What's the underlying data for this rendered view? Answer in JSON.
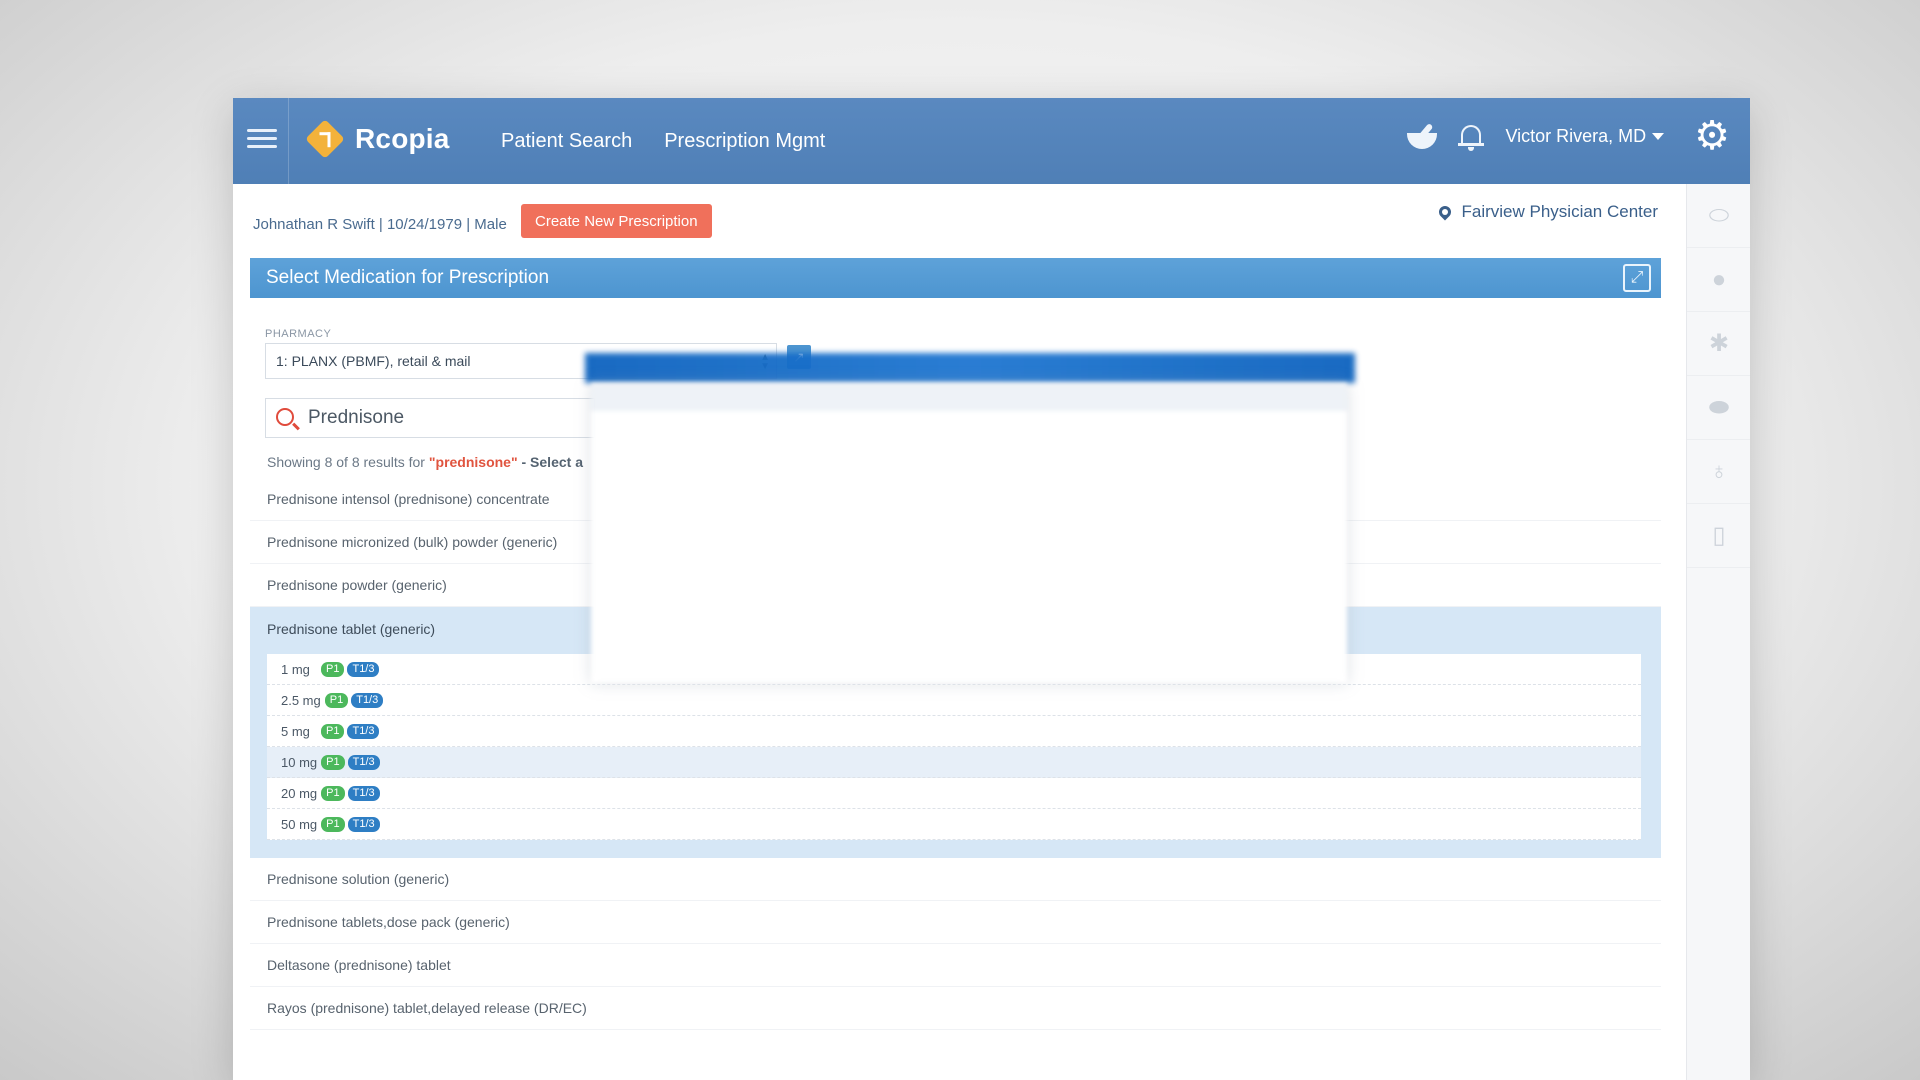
{
  "header": {
    "brand": "Rcopia",
    "nav": [
      {
        "label": "Patient Search"
      },
      {
        "label": "Prescription Mgmt"
      }
    ],
    "user": "Victor Rivera, MD"
  },
  "patient": {
    "info": "Johnathan R Swift | 10/24/1979 | Male",
    "create_button": "Create New Prescription",
    "location": "Fairview Physician Center"
  },
  "section": {
    "title": "Select Medication for Prescription"
  },
  "pharmacy": {
    "label": "PHARMACY",
    "selected": "1: PLANX (PBMF), retail & mail"
  },
  "search": {
    "value": "Prednisone",
    "summary_prefix": "Showing 8 of 8 results for",
    "summary_term": "\"prednisone\"",
    "summary_suffix": " - Select a"
  },
  "results": {
    "before": [
      "Prednisone intensol (prednisone) concentrate",
      "Prednisone micronized (bulk) powder (generic)",
      "Prednisone powder (generic)"
    ],
    "expanded": {
      "name": "Prednisone tablet (generic)",
      "strengths": [
        {
          "label": "1 mg",
          "badges": [
            "P1",
            "T1/3"
          ]
        },
        {
          "label": "2.5 mg",
          "badges": [
            "P1",
            "T1/3"
          ]
        },
        {
          "label": "5 mg",
          "badges": [
            "P1",
            "T1/3"
          ]
        },
        {
          "label": "10 mg",
          "badges": [
            "P1",
            "T1/3"
          ]
        },
        {
          "label": "20 mg",
          "badges": [
            "P1",
            "T1/3"
          ]
        },
        {
          "label": "50 mg",
          "badges": [
            "P1",
            "T1/3"
          ]
        }
      ]
    },
    "after": [
      "Prednisone solution (generic)",
      "Prednisone tablets,dose pack (generic)",
      "Deltasone (prednisone) tablet",
      "Rayos (prednisone) tablet,delayed release (DR/EC)"
    ]
  },
  "icons": {
    "menu": "hamburger-icon",
    "rx": "mortar-pestle-icon",
    "notifications": "bell-icon",
    "settings": "gear-icon",
    "rail": [
      "pill-icon",
      "user-icon",
      "asterisk-icon",
      "pills-icon",
      "stethoscope-icon",
      "document-icon"
    ]
  },
  "colors": {
    "header": "#5a89c0",
    "section": "#5ea2d9",
    "create_button": "#f0705b",
    "badge_p1": "#4cb85c",
    "badge_t13": "#2e7ec4",
    "logo": "#f3b23b"
  }
}
